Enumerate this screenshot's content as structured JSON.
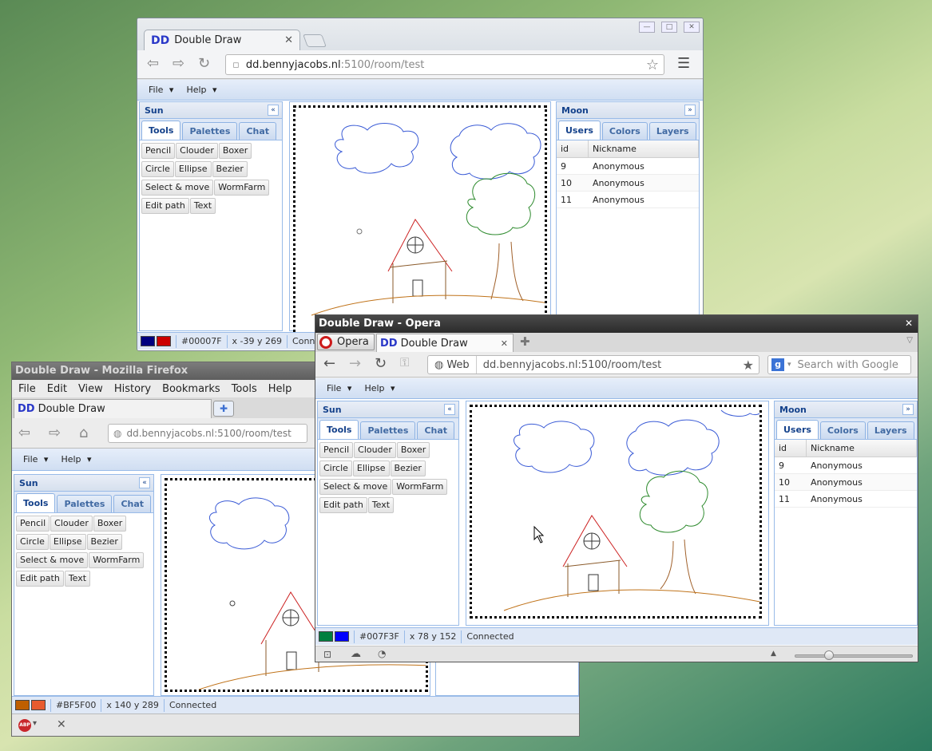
{
  "chrome": {
    "tab_title": "Double Draw",
    "address_host": "dd.bennyjacobs.nl",
    "address_path": ":5100/room/test",
    "favicon": "DD",
    "status_color": "#00007F",
    "status_coords": "x -39 y 269",
    "status_conn": "Connected",
    "swatch1": "#00007F",
    "swatch2": "#CC0000"
  },
  "firefox": {
    "window_title": "Double Draw - Mozilla Firefox",
    "menu": [
      "File",
      "Edit",
      "View",
      "History",
      "Bookmarks",
      "Tools",
      "Help"
    ],
    "tab_title": "Double Draw",
    "address_host": "dd.bennyjacobs.nl",
    "address_path": ":5100/room/test",
    "status_color": "#BF5F00",
    "status_coords": "x 140 y 289",
    "status_conn": "Connected",
    "swatch1": "#BF5F00",
    "swatch2": "#E85B2E"
  },
  "opera": {
    "window_title": "Double Draw - Opera",
    "menu_button": "Opera",
    "tab_title": "Double Draw",
    "web_label": "Web",
    "address_host": "dd.bennyjacobs.nl",
    "address_path": ":5100/room/test",
    "search_placeholder": "Search with Google",
    "status_color": "#007F3F",
    "status_coords": "x 78 y 152",
    "status_conn": "Connected",
    "swatch1": "#007F3F",
    "swatch2": "#0000FF"
  },
  "app": {
    "menu_file": "File",
    "menu_help": "Help",
    "left_panel_title": "Sun",
    "left_tabs": [
      "Tools",
      "Palettes",
      "Chat"
    ],
    "tools": [
      [
        "Pencil",
        "Clouder",
        "Boxer"
      ],
      [
        "Circle",
        "Ellipse",
        "Bezier"
      ],
      [
        "Select & move",
        "WormFarm"
      ],
      [
        "Edit path",
        "Text"
      ]
    ],
    "right_panel_title": "Moon",
    "right_tabs": [
      "Users",
      "Colors",
      "Layers"
    ],
    "users_header": [
      "id",
      "Nickname"
    ],
    "users": [
      [
        "9",
        "Anonymous"
      ],
      [
        "10",
        "Anonymous"
      ],
      [
        "11",
        "Anonymous"
      ]
    ]
  }
}
